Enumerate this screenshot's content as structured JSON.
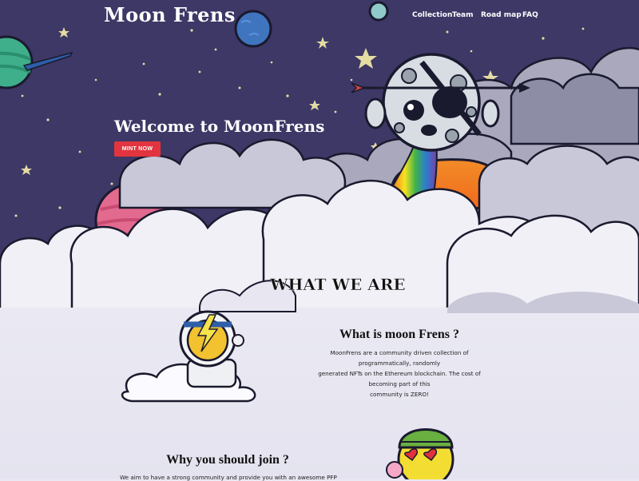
{
  "brand": {
    "logo": "Moon Frens"
  },
  "nav": {
    "items": [
      "Collection",
      "Team",
      "Road map",
      "FAQ"
    ]
  },
  "hero": {
    "title": "Welcome to MoonFrens",
    "cta_label": "MINT NOW"
  },
  "about": {
    "section_title": "WHAT WE ARE",
    "what_title": "What is moon Frens ?",
    "what_body_lines": [
      "MoonFrens are a community driven collection of programmatically, randomly",
      "generated NFTs on the Ethereum blockchain. The cost of becoming part of this",
      "community is ZERO!"
    ],
    "why_title": "Why you should join ?",
    "why_body": "We aim to have a strong community and provide you with an awesome PFP"
  },
  "colors": {
    "sky": "#3d3866",
    "cta": "#e2343f",
    "cloud_light": "#f3f2f9",
    "cloud_dark": "#b7b6c9"
  }
}
